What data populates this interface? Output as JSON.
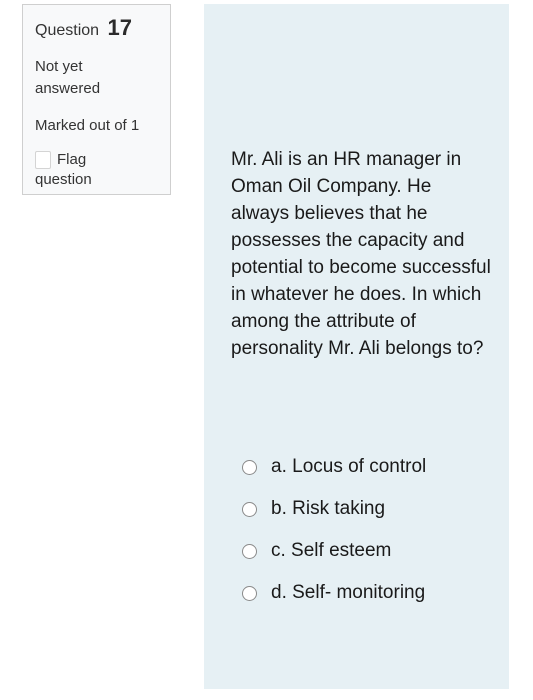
{
  "info": {
    "question_label": "Question",
    "question_number": "17",
    "state": "Not yet answered",
    "grade": "Marked out of 1",
    "flag_line1": "Flag",
    "flag_line2": "question"
  },
  "question": {
    "text": "Mr. Ali is an HR manager in Oman Oil Company. He always believes that he possesses the capacity and potential to become successful in whatever he does. In which among the attribute of personality Mr. Ali belongs to?",
    "answers": [
      {
        "label": "a. Locus of control"
      },
      {
        "label": "b. Risk taking"
      },
      {
        "label": "c. Self esteem"
      },
      {
        "label": "d. Self- monitoring"
      }
    ]
  },
  "colors": {
    "info_background": "#f8f9fa",
    "content_background": "#e6f0f4"
  }
}
